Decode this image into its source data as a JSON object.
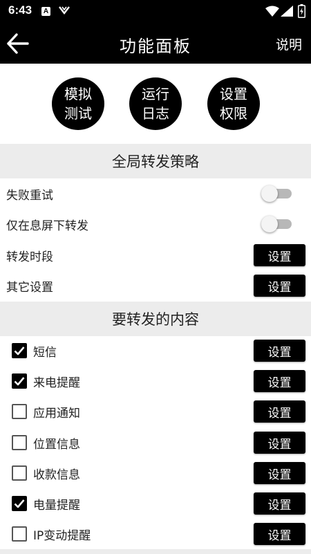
{
  "status_bar": {
    "time": "6:43",
    "icon_a": "A",
    "icons": [
      "a-notification-icon",
      "v-notification-icon",
      "wifi-icon",
      "signal-icon",
      "battery-icon"
    ]
  },
  "app_bar": {
    "title": "功能面板",
    "back_icon": "arrow-left-icon",
    "help": "说明"
  },
  "quick_actions": [
    {
      "line1": "模拟",
      "line2": "测试"
    },
    {
      "line1": "运行",
      "line2": "日志"
    },
    {
      "line1": "设置",
      "line2": "权限"
    }
  ],
  "global_strategy": {
    "header": "全局转发策略",
    "rows": [
      {
        "label": "失败重试",
        "type": "toggle",
        "on": false
      },
      {
        "label": "仅在息屏下转发",
        "type": "toggle",
        "on": false
      },
      {
        "label": "转发时段",
        "type": "button",
        "button": "设置"
      },
      {
        "label": "其它设置",
        "type": "button",
        "button": "设置"
      }
    ]
  },
  "content": {
    "header": "要转发的内容",
    "items": [
      {
        "label": "短信",
        "checked": true,
        "button": "设置"
      },
      {
        "label": "来电提醒",
        "checked": true,
        "button": "设置"
      },
      {
        "label": "应用通知",
        "checked": false,
        "button": "设置"
      },
      {
        "label": "位置信息",
        "checked": false,
        "button": "设置"
      },
      {
        "label": "收款信息",
        "checked": false,
        "button": "设置"
      },
      {
        "label": "电量提醒",
        "checked": true,
        "button": "设置"
      },
      {
        "label": "IP变动提醒",
        "checked": false,
        "button": "设置"
      }
    ]
  },
  "colors": {
    "bar": "#000000",
    "section_bg": "#ececec",
    "button": "#000000",
    "toggle_off_track": "#b8b8b8"
  }
}
